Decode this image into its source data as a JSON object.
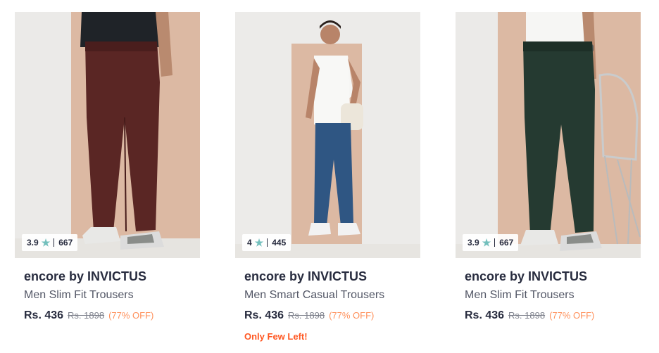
{
  "products": [
    {
      "brand": "encore by INVICTUS",
      "name": "Men Slim Fit Trousers",
      "rating": "3.9",
      "rating_count": "667",
      "price": "Rs. 436",
      "mrp": "Rs. 1898",
      "discount": "(77% OFF)",
      "stock_note": "",
      "image": "maroon-trousers-product-image",
      "trouser_color": "#5a2624"
    },
    {
      "brand": "encore by INVICTUS",
      "name": "Men Smart Casual Trousers",
      "rating": "4",
      "rating_count": "445",
      "price": "Rs. 436",
      "mrp": "Rs. 1898",
      "discount": "(77% OFF)",
      "stock_note": "Only Few Left!",
      "image": "blue-trousers-product-image",
      "trouser_color": "#2f5683"
    },
    {
      "brand": "encore by INVICTUS",
      "name": "Men Slim Fit Trousers",
      "rating": "3.9",
      "rating_count": "667",
      "price": "Rs. 436",
      "mrp": "Rs. 1898",
      "discount": "(77% OFF)",
      "stock_note": "",
      "image": "green-trousers-product-image",
      "trouser_color": "#253a31"
    }
  ],
  "colors": {
    "star": "#72bfbc",
    "discount": "#ff905a",
    "stock_alert": "#ff5722"
  }
}
